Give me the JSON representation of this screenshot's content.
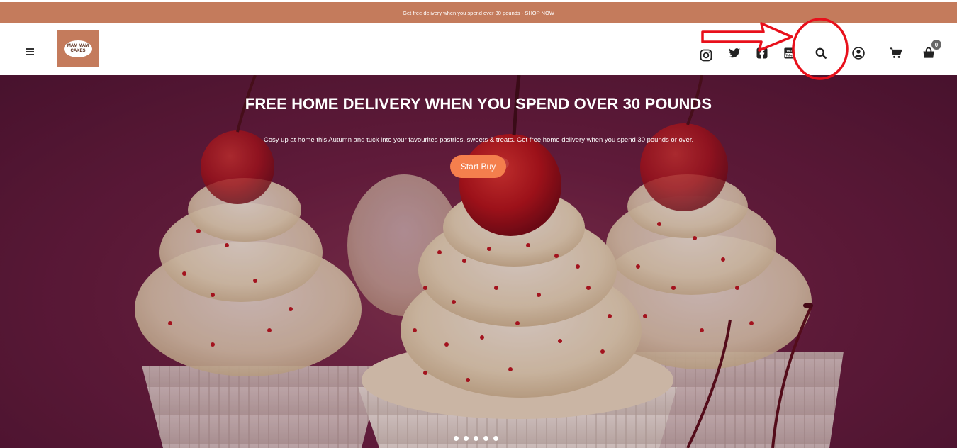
{
  "announcement": {
    "text": "Get free delivery when you spend over 30 pounds - SHOP NOW"
  },
  "header": {
    "logo": {
      "line1": "MAM MAM",
      "line2": "CAKES"
    },
    "icons": [
      {
        "name": "instagram-icon"
      },
      {
        "name": "twitter-icon"
      },
      {
        "name": "facebook-icon"
      },
      {
        "name": "youtube-icon"
      },
      {
        "name": "search-icon"
      },
      {
        "name": "account-icon"
      },
      {
        "name": "cart-icon"
      },
      {
        "name": "shopping-bag-icon"
      }
    ],
    "cart_count": "0"
  },
  "hero": {
    "title": "FREE HOME DELIVERY WHEN YOU SPEND OVER 30 POUNDS",
    "subtitle": "Cosy up at home this Autumn and tuck into your favourites pastries, sweets & treats. Get free home delivery when you spend 30 pounds or over.",
    "cta_label": "Start Buy",
    "slide_count": 5
  },
  "colors": {
    "announcement_bg": "#c47b5c",
    "cta": "#f47f4d",
    "hero_bg": "#6a2040",
    "annotation": "#e8101b"
  }
}
